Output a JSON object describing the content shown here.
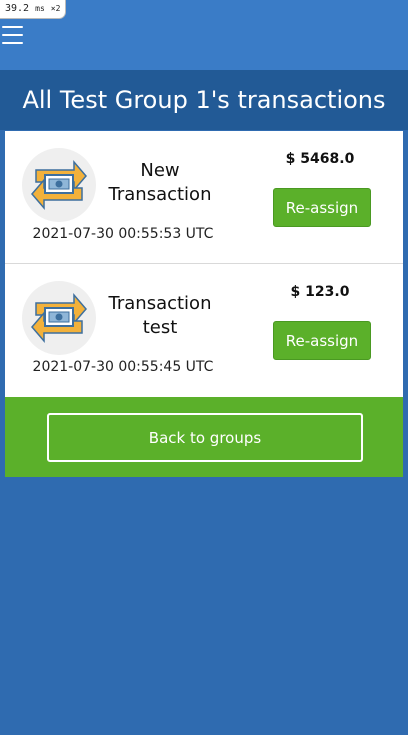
{
  "perf_overlay": {
    "value": "39.2",
    "unit": "ms",
    "multiplier": "×2"
  },
  "header": {
    "menu_icon": "hamburger-icon"
  },
  "page": {
    "title": "All Test Group 1's transactions"
  },
  "transactions": [
    {
      "name": "New Transaction",
      "date": "2021-07-30 00:55:53 UTC",
      "amount": "$ 5468.0",
      "action_label": "Re-assign",
      "icon": "money-transfer-icon"
    },
    {
      "name": "Transaction test",
      "date": "2021-07-30 00:55:45 UTC",
      "amount": "$ 123.0",
      "action_label": "Re-assign",
      "icon": "money-transfer-icon"
    }
  ],
  "footer": {
    "back_label": "Back to groups"
  },
  "colors": {
    "background": "#2f6bb0",
    "topbar": "#3a7cc7",
    "title_band": "#225a96",
    "accent_green": "#5bb02a",
    "icon_arrow": "#f2b13b",
    "icon_money": "#3d6f9e"
  }
}
